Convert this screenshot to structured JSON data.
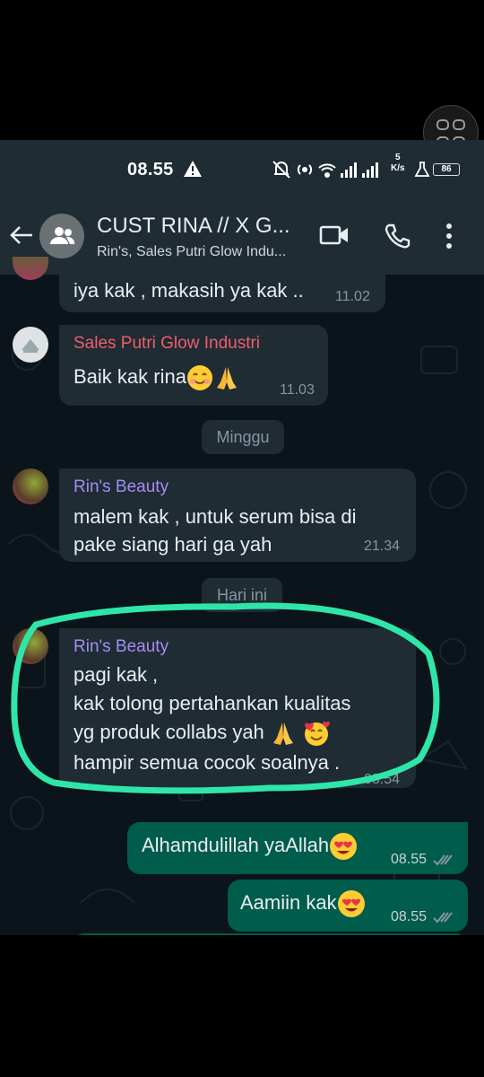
{
  "status_bar": {
    "time": "08.55",
    "net_speed_value": "5",
    "net_speed_unit": "K/s",
    "battery": "86",
    "icons": [
      "alert-icon",
      "mute-icon",
      "hotspot-icon",
      "wifi-icon",
      "signal-icon",
      "signal-icon",
      "flask-icon"
    ]
  },
  "header": {
    "title": "CUST RINA // X G...",
    "subtitle": "Rin's, Sales Putri Glow Indu..."
  },
  "messages": [
    {
      "text": "iya kak , makasih ya kak ..",
      "time": "11.02"
    },
    {
      "sender": "Sales Putri Glow Industri",
      "sender_color": "#f15c6d",
      "text": "Baik kak rina",
      "emoji": [
        "smiling-face-icon",
        "folded-hands-icon"
      ],
      "time": "11.03"
    },
    {
      "sender": "Rin's Beauty",
      "sender_color": "#a48cf5",
      "lines": [
        "malem kak , untuk serum bisa di",
        "pake siang hari ga yah"
      ],
      "time": "21.34"
    },
    {
      "sender": "Rin's Beauty",
      "sender_color": "#a48cf5",
      "lines": [
        "pagi kak ,",
        "kak tolong pertahankan kualitas",
        "yg produk collabs yah",
        "hampir semua cocok soalnya ."
      ],
      "emoji": [
        "folded-hands-icon",
        "smiling-face-hearts-icon"
      ],
      "time": "08.54"
    },
    {
      "text": "Alhamdulillah yaAllah",
      "emoji": [
        "heart-eyes-icon"
      ],
      "time": "08.55"
    },
    {
      "text": "Aamiin kak",
      "emoji": [
        "heart-eyes-icon"
      ],
      "time": "08.55"
    }
  ],
  "date_chips": [
    "Minggu",
    "Hari ini"
  ],
  "colors": {
    "incoming": "#1f2c34",
    "outgoing": "#005c4b",
    "highlight": "#2fe6a8",
    "background": "#0b141a"
  }
}
